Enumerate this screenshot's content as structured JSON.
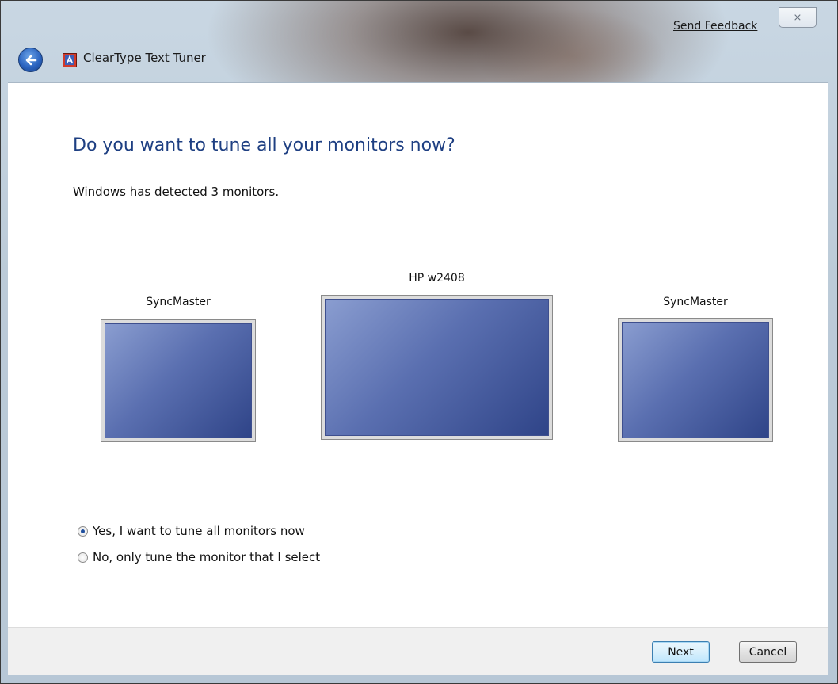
{
  "window": {
    "title": "ClearType Text Tuner",
    "feedback_link": "Send Feedback",
    "close_glyph": "⨯"
  },
  "main": {
    "heading": "Do you want to tune all your monitors now?",
    "detected_text": "Windows has detected 3 monitors.",
    "monitors": [
      {
        "label": "SyncMaster"
      },
      {
        "label": "HP w2408"
      },
      {
        "label": "SyncMaster"
      }
    ],
    "options": [
      {
        "label": "Yes, I want to tune all monitors now",
        "selected": true
      },
      {
        "label": "No, only tune the monitor that I select",
        "selected": false
      }
    ]
  },
  "footer": {
    "next_label": "Next",
    "cancel_label": "Cancel"
  },
  "colors": {
    "heading": "#1e3f82",
    "monitor_screen": "#4a5fa3"
  },
  "icons": [
    "back-arrow-icon",
    "cleartype-app-icon",
    "close-icon"
  ]
}
